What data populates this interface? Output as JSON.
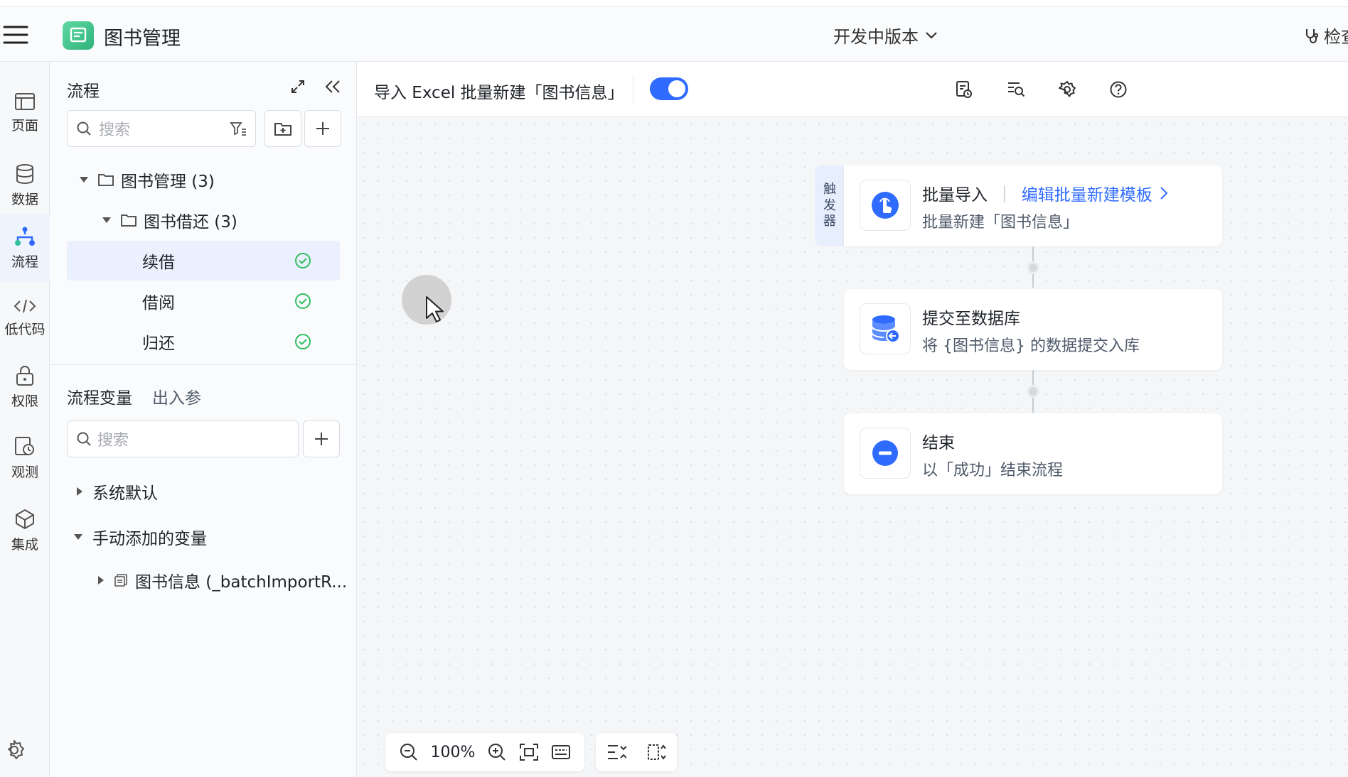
{
  "app": {
    "title": "图书管理",
    "version": "开发中版本",
    "inspect": "检查"
  },
  "rail": {
    "items": [
      {
        "label": "页面",
        "icon": "layout-icon"
      },
      {
        "label": "数据",
        "icon": "database-icon"
      },
      {
        "label": "流程",
        "icon": "flow-icon"
      },
      {
        "label": "低代码",
        "icon": "code-icon"
      },
      {
        "label": "权限",
        "icon": "lock-icon"
      },
      {
        "label": "观测",
        "icon": "observe-icon"
      },
      {
        "label": "集成",
        "icon": "integration-icon"
      }
    ]
  },
  "panel": {
    "title": "流程",
    "search_placeholder": "搜索",
    "tree": [
      {
        "label": "图书管理 (3)"
      },
      {
        "label": "图书借还 (3)"
      },
      {
        "label": "续借"
      },
      {
        "label": "借阅"
      },
      {
        "label": "归还"
      }
    ],
    "var_tabs": [
      "流程变量",
      "出入参"
    ],
    "var_search_placeholder": "搜索",
    "var_groups": [
      {
        "label": "系统默认"
      },
      {
        "label": "手动添加的变量"
      },
      {
        "label": "图书信息 (_batchImportR..."
      }
    ]
  },
  "canvas": {
    "flow_name": "导入 Excel 批量新建「图书信息」",
    "enabled": true,
    "trigger_tab": [
      "触",
      "发",
      "器"
    ],
    "nodes": [
      {
        "title": "批量导入",
        "link": "编辑批量新建模板",
        "desc": "批量新建「图书信息」"
      },
      {
        "title": "提交至数据库",
        "desc": "将 {图书信息} 的数据提交入库"
      },
      {
        "title": "结束",
        "desc": "以「成功」结束流程"
      }
    ],
    "zoom": "100%"
  },
  "colors": {
    "accent": "#2f6bff",
    "success": "#2fbf5f"
  }
}
